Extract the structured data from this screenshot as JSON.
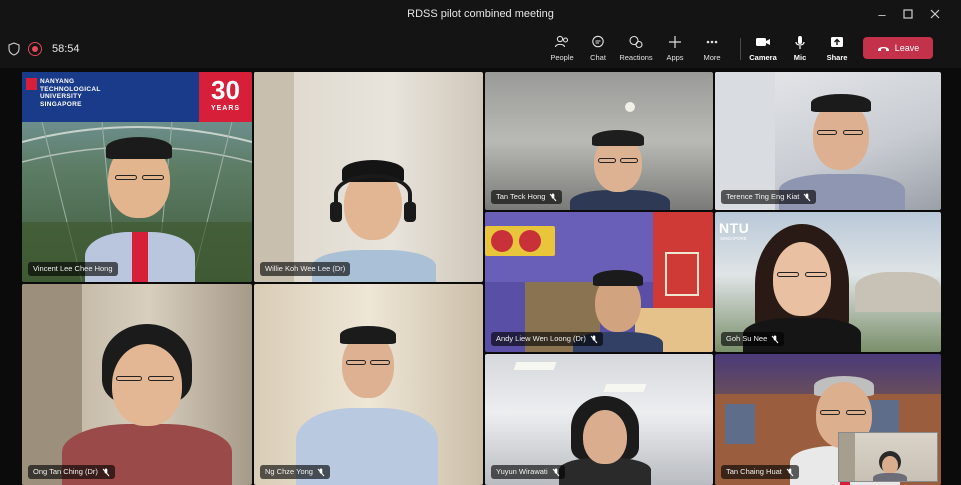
{
  "window": {
    "title": "RDSS pilot combined meeting",
    "controls": [
      "minimize-icon",
      "maximize-icon",
      "close-icon"
    ]
  },
  "toolbar": {
    "timer": "58:54",
    "buttons": [
      {
        "label": "People",
        "icon": "people-icon"
      },
      {
        "label": "Chat",
        "icon": "chat-icon"
      },
      {
        "label": "Reactions",
        "icon": "reactions-icon"
      },
      {
        "label": "Apps",
        "icon": "apps-plus-icon"
      },
      {
        "label": "More",
        "icon": "more-icon"
      },
      {
        "label": "Camera",
        "icon": "camera-icon"
      },
      {
        "label": "Mic",
        "icon": "mic-icon"
      },
      {
        "label": "Share",
        "icon": "share-icon"
      }
    ],
    "leave_label": "Leave",
    "leave_color": "#c4314b"
  },
  "ntu_banner": {
    "lines": [
      "NANYANG",
      "TECHNOLOGICAL",
      "UNIVERSITY",
      "SINGAPORE"
    ],
    "years_number": "30",
    "years_label": "YEARS"
  },
  "ntu_background": {
    "logo": "NTU",
    "sub": "SINGAPORE"
  },
  "participants": [
    {
      "name": "Vincent Lee Chee Hong",
      "muted": false
    },
    {
      "name": "Willie Koh Wee Lee (Dr)",
      "muted": false
    },
    {
      "name": "Tan Teck Hong",
      "muted": true
    },
    {
      "name": "Terence Ting Eng Kiat",
      "muted": true
    },
    {
      "name": "Andy Liew Wen Loong (Dr)",
      "muted": true
    },
    {
      "name": "Goh Su Nee",
      "muted": true
    },
    {
      "name": "Ong Tan Ching (Dr)",
      "muted": true
    },
    {
      "name": "Ng Chze Yong",
      "muted": true
    },
    {
      "name": "Yuyun Wirawati",
      "muted": true
    },
    {
      "name": "Tan Chaing Huat",
      "muted": true
    }
  ]
}
